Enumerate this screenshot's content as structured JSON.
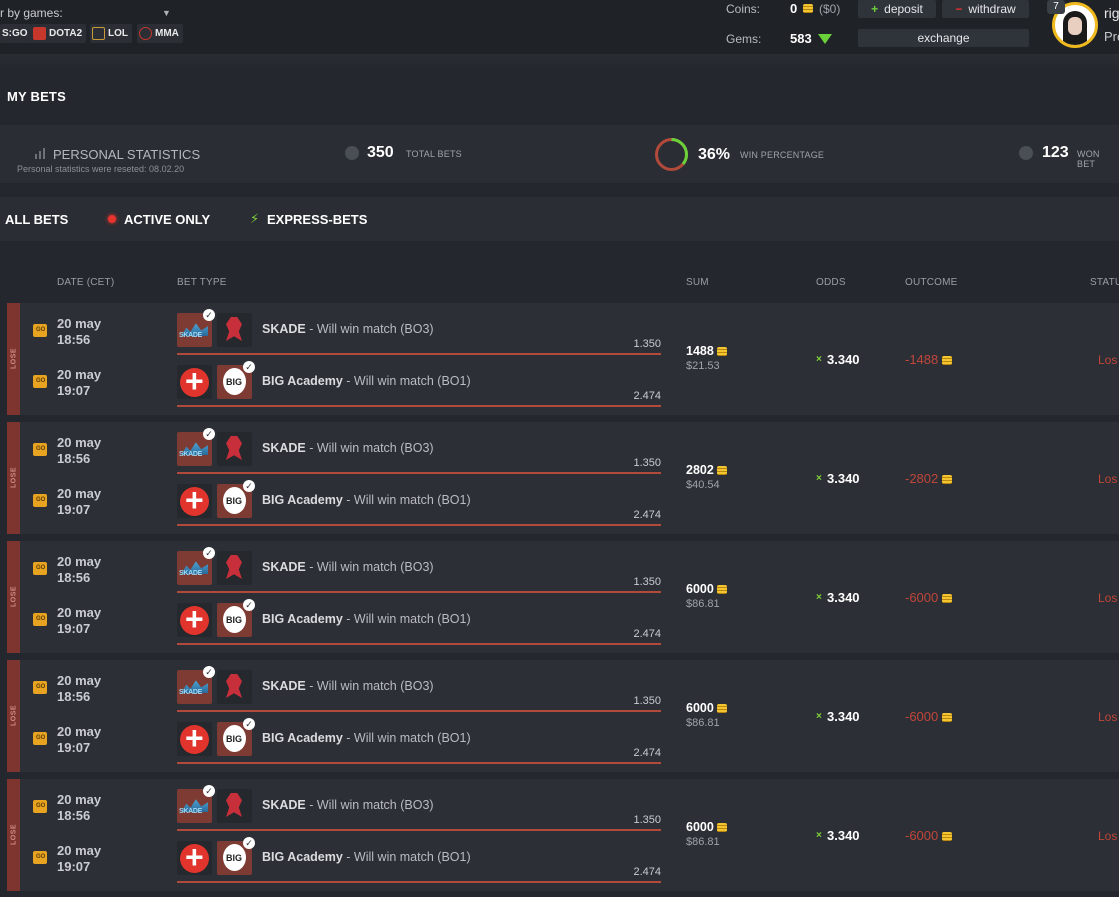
{
  "header": {
    "filter_label": "r by games:",
    "games": [
      {
        "label": "S:GO",
        "icon": "csgo-icon",
        "color": "#e8a321"
      },
      {
        "label": "DOTA2",
        "icon": "dota2-icon",
        "color": "#c7372c"
      },
      {
        "label": "LOL",
        "icon": "lol-icon",
        "color": "#c79b3a"
      },
      {
        "label": "MMA",
        "icon": "mma-icon",
        "color": "#c7372c"
      }
    ],
    "coins_label": "Coins:",
    "coins_value": "0",
    "coins_usd": "($0)",
    "gems_label": "Gems:",
    "gems_value": "583",
    "deposit_sign": "+",
    "deposit_label": "deposit",
    "withdraw_sign": "−",
    "withdraw_label": "withdraw",
    "exchange_label": "exchange",
    "user_level": "7",
    "username": "rig",
    "user_rank": "Pre"
  },
  "page_title": "MY BETS",
  "stats": {
    "title": "PERSONAL STATISTICS",
    "subtitle": "Personal statistics were reseted: 08.02.20",
    "total_bets_value": "350",
    "total_bets_label": "TOTAL BETS",
    "win_pct_value": "36%",
    "win_pct_label": "WIN PERCENTAGE",
    "win_pct_fraction": 0.36,
    "won_bets_value": "123",
    "won_bets_label": "WON BET"
  },
  "tabs": {
    "all": "ALL BETS",
    "active": "ACTIVE ONLY",
    "express": "EXPRESS-BETS"
  },
  "table": {
    "headers": {
      "date": "DATE (CET)",
      "bet_type": "BET TYPE",
      "sum": "SUM",
      "odds": "ODDS",
      "outcome": "OUTCOME",
      "status": "STATU"
    },
    "rows": [
      {
        "result": "LOSE",
        "legs": [
          {
            "date": "20 may",
            "time": "18:56",
            "team": "SKADE",
            "desc": " - Will win match (BO3)",
            "odd": "1.350"
          },
          {
            "date": "20 may",
            "time": "19:07",
            "team": "BIG Academy",
            "desc": " - Will win match (BO1)",
            "odd": "2.474"
          }
        ],
        "sum": "1488",
        "sum_usd": "$21.53",
        "odds_x": "×",
        "odds": "3.340",
        "outcome": "-1488",
        "status": "Los"
      },
      {
        "result": "LOSE",
        "legs": [
          {
            "date": "20 may",
            "time": "18:56",
            "team": "SKADE",
            "desc": " - Will win match (BO3)",
            "odd": "1.350"
          },
          {
            "date": "20 may",
            "time": "19:07",
            "team": "BIG Academy",
            "desc": " - Will win match (BO1)",
            "odd": "2.474"
          }
        ],
        "sum": "2802",
        "sum_usd": "$40.54",
        "odds_x": "×",
        "odds": "3.340",
        "outcome": "-2802",
        "status": "Los"
      },
      {
        "result": "LOSE",
        "legs": [
          {
            "date": "20 may",
            "time": "18:56",
            "team": "SKADE",
            "desc": " - Will win match (BO3)",
            "odd": "1.350"
          },
          {
            "date": "20 may",
            "time": "19:07",
            "team": "BIG Academy",
            "desc": " - Will win match (BO1)",
            "odd": "2.474"
          }
        ],
        "sum": "6000",
        "sum_usd": "$86.81",
        "odds_x": "×",
        "odds": "3.340",
        "outcome": "-6000",
        "status": "Los"
      },
      {
        "result": "LOSE",
        "legs": [
          {
            "date": "20 may",
            "time": "18:56",
            "team": "SKADE",
            "desc": " - Will win match (BO3)",
            "odd": "1.350"
          },
          {
            "date": "20 may",
            "time": "19:07",
            "team": "BIG Academy",
            "desc": " - Will win match (BO1)",
            "odd": "2.474"
          }
        ],
        "sum": "6000",
        "sum_usd": "$86.81",
        "odds_x": "×",
        "odds": "3.340",
        "outcome": "-6000",
        "status": "Los"
      },
      {
        "result": "LOSE",
        "legs": [
          {
            "date": "20 may",
            "time": "18:56",
            "team": "SKADE",
            "desc": " - Will win match (BO3)",
            "odd": "1.350"
          },
          {
            "date": "20 may",
            "time": "19:07",
            "team": "BIG Academy",
            "desc": " - Will win match (BO1)",
            "odd": "2.474"
          }
        ],
        "sum": "6000",
        "sum_usd": "$86.81",
        "odds_x": "×",
        "odds": "3.340",
        "outcome": "-6000",
        "status": "Los"
      }
    ]
  }
}
